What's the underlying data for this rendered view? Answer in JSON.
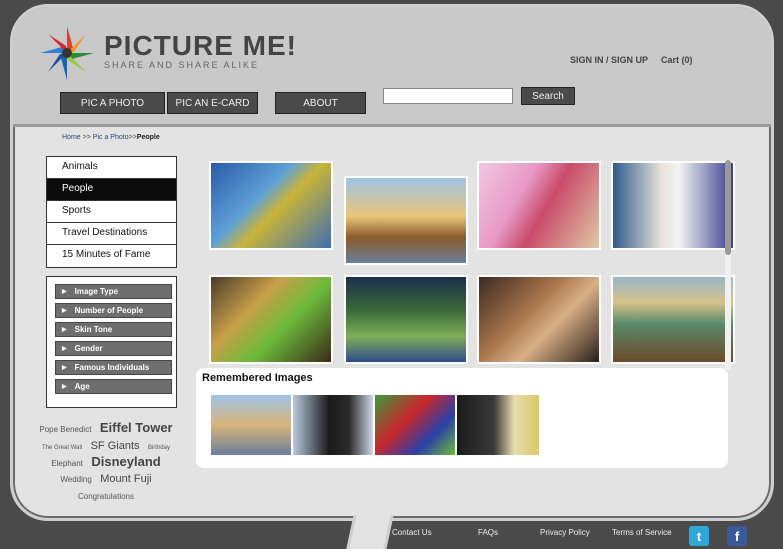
{
  "brand": {
    "title": "PICTURE ME!",
    "tagline": "SHARE AND SHARE ALIKE"
  },
  "header": {
    "sign_in": "SIGN IN / SIGN UP",
    "cart": "Cart (0)"
  },
  "nav": {
    "pic_a_photo": "PIC A PHOTO",
    "pic_an_ecard": "PIC AN E-CARD",
    "about": "ABOUT"
  },
  "search": {
    "button": "Search",
    "value": ""
  },
  "breadcrumb": {
    "home": "Home",
    "sep1": ">>",
    "pic": "Pic a Photo",
    "sep2": ">>",
    "current": "People"
  },
  "categories": [
    "Animals",
    "People",
    "Sports",
    "Travel Destinations",
    "15 Minutes of Fame"
  ],
  "active_category": "People",
  "filters": [
    "Image Type",
    "Number of People",
    "Skin Tone",
    "Gender",
    "Famous Individuals",
    "Age"
  ],
  "tags": {
    "t1": "Pope Benedict",
    "t2": "Eiffel Tower",
    "t3": "The Great Wall",
    "t4": "SF Giants",
    "t5": "Birthday",
    "t6": "Elephant",
    "t7": "Disneyland",
    "t8": "Wedding",
    "t9": "Mount Fuji",
    "t10": "Congratulations"
  },
  "remembered": {
    "title": "Remembered Images"
  },
  "footer": {
    "contact": "Contact Us",
    "faqs": "FAQs",
    "privacy": "Privacy Policy",
    "terms": "Terms of Service"
  },
  "colors": {
    "accent": "#4a4a4a",
    "twitter": "#2fa7d9",
    "facebook": "#3b5998",
    "link": "#2a3d8f"
  }
}
